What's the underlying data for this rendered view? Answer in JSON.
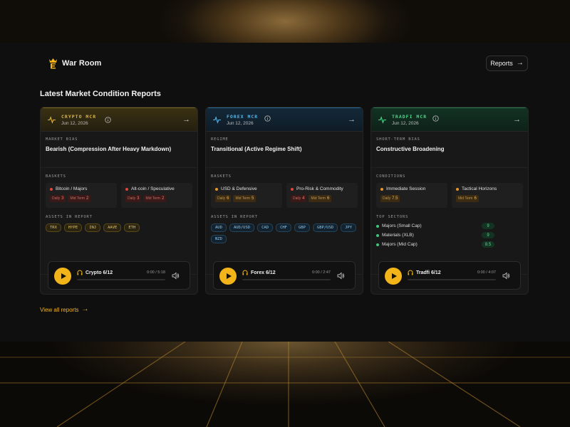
{
  "brand": {
    "name": "War Room",
    "logo_icon": "crown-logo-icon",
    "accent": "#f2b418"
  },
  "header": {
    "reports_label": "Reports",
    "reports_icon": "arrow-right-icon"
  },
  "section_title": "Latest Market Condition Reports",
  "cards": [
    {
      "label": "CRYPTO MCR",
      "date": "Jun 12, 2026",
      "accent": "#e0b23a",
      "bias_label": "MARKET BIAS",
      "bias_value": "Bearish (Compression After Heavy Markdown)",
      "group_label": "BASKETS",
      "baskets": [
        {
          "title": "Bitcoin / Majors",
          "status": "red",
          "tags": [
            {
              "label": "Daily",
              "value": "3"
            },
            {
              "label": "Mid Term",
              "value": "2"
            }
          ]
        },
        {
          "title": "Alt-coin / Speculative",
          "status": "red",
          "tags": [
            {
              "label": "Daily",
              "value": "3"
            },
            {
              "label": "Mid Term",
              "value": "2"
            }
          ]
        }
      ],
      "assets_label": "ASSETS IN REPORT",
      "assets": [
        "TRX",
        "HYPE",
        "INJ",
        "AAVE",
        "ETH"
      ],
      "player": {
        "title": "Crypto 6/12",
        "time": "0:00 / 5:18",
        "progress": 0
      }
    },
    {
      "label": "FOREX MCR",
      "date": "Jun 12, 2026",
      "accent": "#58b4e8",
      "bias_label": "REGIME",
      "bias_value": "Transitional (Active Regime Shift)",
      "group_label": "BASKETS",
      "baskets": [
        {
          "title": "USD & Defensive",
          "status": "orange",
          "tags": [
            {
              "label": "Daily",
              "value": "6"
            },
            {
              "label": "Mid Term",
              "value": "5"
            }
          ]
        },
        {
          "title": "Pro-Risk & Commodity",
          "status": "red",
          "tags": [
            {
              "label": "Daily",
              "value": "4"
            },
            {
              "label": "Mid Term",
              "value": "6"
            }
          ]
        }
      ],
      "assets_label": "ASSETS IN REPORT",
      "assets": [
        "AUD",
        "AUD/USD",
        "CAD",
        "CHF",
        "GBP",
        "GBP/USD",
        "JPY",
        "NZD"
      ],
      "player": {
        "title": "Forex 6/12",
        "time": "0:00 / 2:47",
        "progress": 0
      }
    },
    {
      "label": "TRADFI MCR",
      "date": "Jun 12, 2026",
      "accent": "#4bd489",
      "bias_label": "SHORT-TERM BIAS",
      "bias_value": "Constructive Broadening",
      "group_label": "CONDITIONS",
      "baskets": [
        {
          "title": "Immediate Session",
          "status": "orange",
          "tags": [
            {
              "label": "Daily",
              "value": "7.5"
            }
          ]
        },
        {
          "title": "Tactical Horizons",
          "status": "orange",
          "tags": [
            {
              "label": "Mid Term",
              "value": "6"
            }
          ]
        }
      ],
      "assets_label": "TOP SECTORS",
      "sectors": [
        {
          "name": "Majors (Small Cap)",
          "score": "9"
        },
        {
          "name": "Materials (XLB)",
          "score": "9"
        },
        {
          "name": "Majors (Mid Cap)",
          "score": "8.5"
        }
      ],
      "player": {
        "title": "Tradfi 6/12",
        "time": "0:00 / 4:07",
        "progress": 0
      }
    }
  ],
  "view_all": "View all reports"
}
